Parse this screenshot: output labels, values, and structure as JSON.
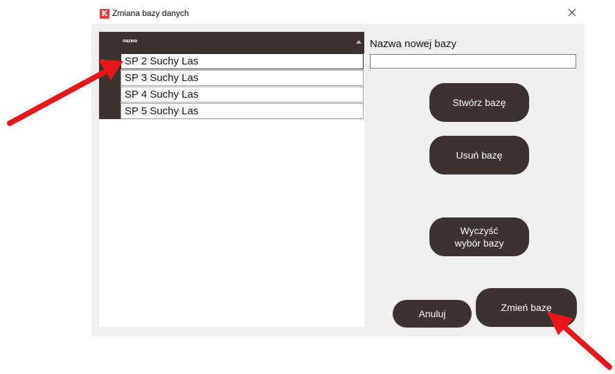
{
  "window": {
    "title": "Zmiana bazy danych",
    "icon": "K-app-icon",
    "close_glyph": "×"
  },
  "grid": {
    "column_header": "nazwa",
    "rows": [
      "SP 2 Suchy Las",
      "SP 3 Suchy Las",
      "SP 4 Suchy Las",
      "SP 5 Suchy Las"
    ],
    "selected_index": 0
  },
  "form": {
    "new_db_label": "Nazwa nowej bazy",
    "new_db_value": ""
  },
  "buttons": {
    "create": "Stwórz bazę",
    "delete": "Usuń bazę",
    "clear_line1": "Wyczyść",
    "clear_line2": "wybór bazy",
    "cancel": "Anuluj",
    "change": "Zmień bazę"
  },
  "colors": {
    "button_bg": "#3c3330",
    "dialog_bg": "#f0f0f0",
    "annotation_arrow": "#e8161b",
    "app_icon": "#e8393f"
  }
}
